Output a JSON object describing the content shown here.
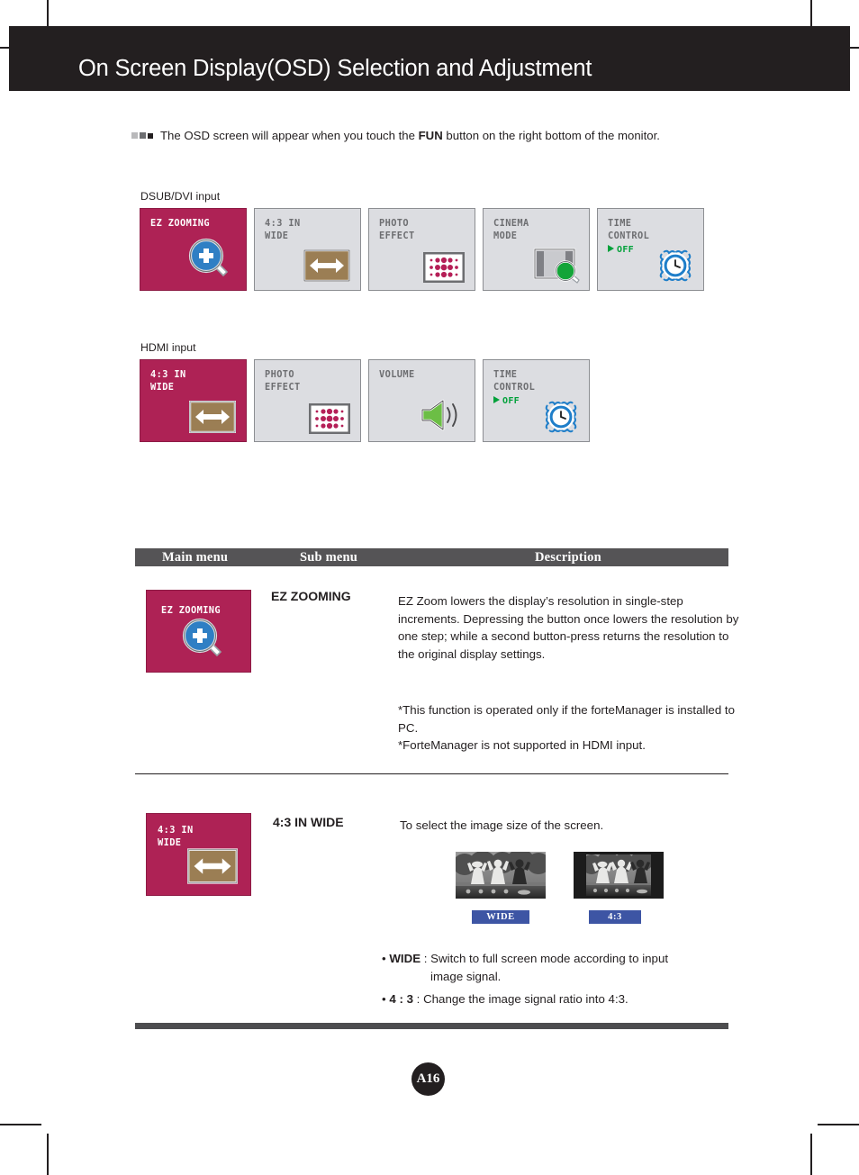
{
  "header": {
    "title": "On Screen Display(OSD) Selection and Adjustment"
  },
  "intro": {
    "text_before": "The OSD screen will appear when you touch the ",
    "bold": "FUN",
    "text_after": " button on the right bottom of the monitor."
  },
  "groups": [
    {
      "label": "DSUB/DVI input",
      "tiles": [
        {
          "label": "EZ  ZOOMING",
          "icon": "magnifier-plus-icon",
          "highlight": true,
          "status": ""
        },
        {
          "label": "4:3  IN\nWIDE",
          "icon": "left-right-arrow-icon",
          "highlight": false,
          "status": ""
        },
        {
          "label": "PHOTO\nEFFECT",
          "icon": "dot-grid-icon",
          "highlight": false,
          "status": ""
        },
        {
          "label": "CINEMA\nMODE",
          "icon": "cinema-screen-icon",
          "highlight": false,
          "status": ""
        },
        {
          "label": "TIME\nCONTROL",
          "icon": "alarm-clock-icon",
          "highlight": false,
          "status": "OFF"
        }
      ]
    },
    {
      "label": "HDMI input",
      "tiles": [
        {
          "label": "4:3  IN\nWIDE",
          "icon": "left-right-arrow-icon",
          "highlight": true,
          "status": ""
        },
        {
          "label": "PHOTO\nEFFECT",
          "icon": "dot-grid-icon",
          "highlight": false,
          "status": ""
        },
        {
          "label": "VOLUME",
          "icon": "speaker-icon",
          "highlight": false,
          "status": ""
        },
        {
          "label": "TIME\nCONTROL",
          "icon": "alarm-clock-icon",
          "highlight": false,
          "status": "OFF"
        }
      ]
    }
  ],
  "table": {
    "headers": {
      "main_menu": "Main menu",
      "sub_menu": "Sub menu",
      "description": "Description"
    },
    "rows": [
      {
        "icon_label": "EZ  ZOOMING",
        "icon": "magnifier-plus-icon",
        "sub_menu": "EZ ZOOMING",
        "description_p1": "EZ Zoom lowers the display’s resolution in single-step increments. Depressing the button once lowers the resolution by one step; while a second button-press returns the resolution to the original display settings.",
        "description_p2": "*This function is operated only if the forteManager is installed to PC.\n*ForteManager is not supported in HDMI input."
      },
      {
        "icon_label": "4:3  IN\nWIDE",
        "icon": "left-right-arrow-icon",
        "sub_menu": "4:3 IN WIDE",
        "description_p1": "To select the image size of the screen.",
        "samples": [
          {
            "chip": "WIDE",
            "alt": "wide-screen-sample-photo"
          },
          {
            "chip": "4:3",
            "alt": "four-three-sample-photo"
          }
        ],
        "bullets": [
          {
            "term": "WIDE",
            "sep": " : ",
            "text": "Switch to full screen mode according to input",
            "cont": "image signal."
          },
          {
            "term": "4 : 3",
            "sep": " : ",
            "text": "Change the image signal ratio into 4:3.",
            "cont": ""
          }
        ]
      }
    ]
  },
  "footer": {
    "page": "A16"
  },
  "colors": {
    "header_bar": "#231f20",
    "accent_pink": "#ae2255",
    "tile_grey": "#dcdde1",
    "table_header": "#555456",
    "bottom_bar": "#4d4d4f",
    "status_green": "#00a13a",
    "chip_blue": "#3d55a4",
    "arrow_tan": "#9b7e54",
    "magnifier_blue": "#2f7fc4"
  }
}
